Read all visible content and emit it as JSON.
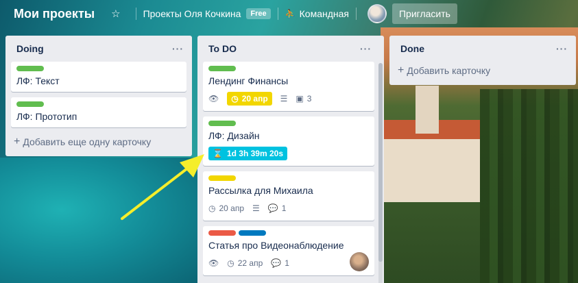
{
  "header": {
    "board_title": "Мои проекты",
    "team_name": "Проекты Оля Кочкина",
    "plan_badge": "Free",
    "visibility": "Командная",
    "invite_label": "Пригласить"
  },
  "lists": [
    {
      "title": "Doing",
      "cards": [
        {
          "title": "ЛФ: Текст",
          "labels": [
            "#61bd4f"
          ]
        },
        {
          "title": "ЛФ: Прототип",
          "labels": [
            "#61bd4f"
          ]
        }
      ],
      "add_label": "Добавить еще одну карточку"
    },
    {
      "title": "To DO",
      "cards": [
        {
          "title": "Лендинг Финансы",
          "labels": [
            "#61bd4f"
          ],
          "due": "20 апр",
          "checklist": "3"
        },
        {
          "title": "ЛФ: Дизайн",
          "labels": [
            "#61bd4f"
          ],
          "timer": "1d 3h 39m 20s"
        },
        {
          "title": "Рассылка для Михаила",
          "labels": [
            "#f2d600"
          ],
          "due": "20 апр",
          "comments": "1"
        },
        {
          "title": "Статья про Видеонаблюдение",
          "labels": [
            "#eb5a46",
            "#0079bf"
          ],
          "due": "22 апр",
          "comments": "1"
        }
      ]
    },
    {
      "title": "Done",
      "add_label": "Добавить карточку"
    }
  ],
  "menu_glyph": "···",
  "colors": {
    "accent_timer": "#00c2e0",
    "due_yellow": "#f2d600",
    "arrow": "#f5ee2b"
  }
}
